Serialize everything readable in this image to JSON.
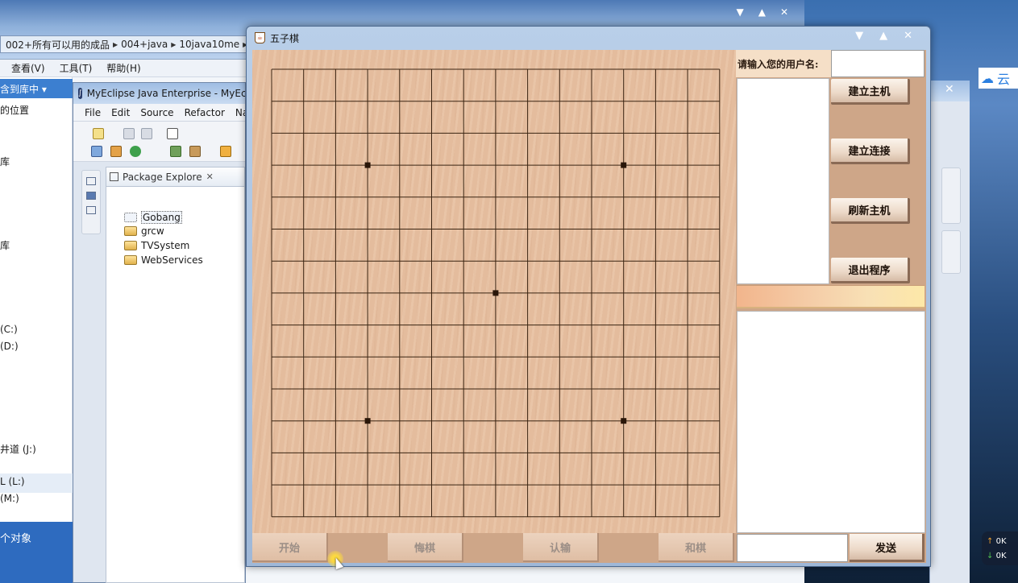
{
  "explorer": {
    "breadcrumb": [
      "002+所有可以用的成品",
      "004+java",
      "10java10me"
    ],
    "menu": [
      "查看(V)",
      "工具(T)",
      "帮助(H)"
    ],
    "left_items": [
      {
        "label": "含到库中",
        "top": 0
      },
      {
        "label": "的位置",
        "top": 0
      },
      {
        "label": "库",
        "top": 0
      },
      {
        "label": "库",
        "top": 0
      },
      {
        "label": "(C:)",
        "top": 0
      },
      {
        "label": "(D:)",
        "top": 0
      },
      {
        "label": "井道 (J:)",
        "top": 0
      },
      {
        "label": "L (L:)",
        "top": 0
      },
      {
        "label": "(M:)",
        "top": 0
      }
    ],
    "status_text": "个对象"
  },
  "eclipse": {
    "title": "MyEclipse Java Enterprise - MyEclipse",
    "menu": [
      "File",
      "Edit",
      "Source",
      "Refactor",
      "Navigate"
    ],
    "package_tab": "Package Explore",
    "projects": [
      "Gobang",
      "grcw",
      "TVSystem",
      "WebServices"
    ]
  },
  "right_window": {
    "close_glyph": "✕",
    "cloud_text": "云"
  },
  "netspeed": {
    "up": "0K",
    "down": "0K"
  },
  "gobang": {
    "title": "五子棋",
    "board": {
      "lines": 15,
      "star_points": [
        [
          3,
          3
        ],
        [
          3,
          11
        ],
        [
          7,
          7
        ],
        [
          11,
          3
        ],
        [
          11,
          11
        ]
      ]
    },
    "username_label": "请输入您的用户名:",
    "username_value": "",
    "buttons": {
      "create_host": "建立主机",
      "connect": "建立连接",
      "refresh_host": "刷新主机",
      "exit": "退出程序"
    },
    "bottom_buttons": [
      "开始",
      "悔棋",
      "认输",
      "和棋"
    ],
    "chat_input_value": "",
    "send": "发送"
  }
}
